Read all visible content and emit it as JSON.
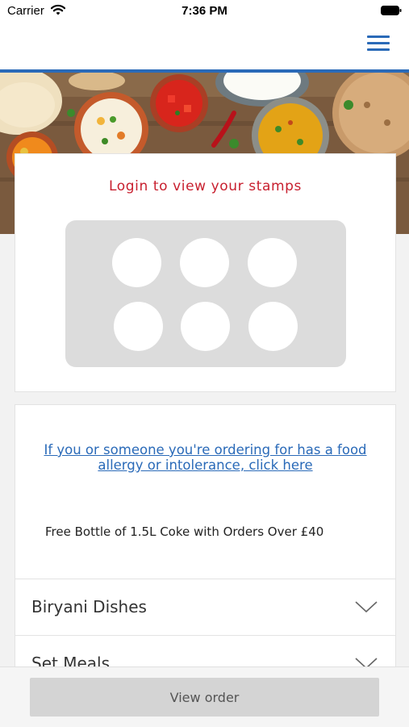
{
  "status_bar": {
    "carrier": "Carrier",
    "time": "7:36 PM"
  },
  "stamps": {
    "title": "Login to view your stamps",
    "count": 6
  },
  "info": {
    "allergy_link": "If you or someone you're ordering for has a food allergy or intolerance, click here",
    "promo": "Free Bottle of 1.5L Coke with Orders Over £40"
  },
  "menu_categories": [
    {
      "label": "Biryani Dishes"
    },
    {
      "label": "Set Meals"
    }
  ],
  "bottom_bar": {
    "view_order_label": "View order"
  },
  "colors": {
    "accent_blue": "#2a6ab8",
    "title_red": "#c8202f",
    "stamp_panel": "#dcdcdc"
  },
  "icons": [
    "wifi-icon",
    "battery-icon",
    "hamburger-menu-icon",
    "chevron-down-icon"
  ]
}
